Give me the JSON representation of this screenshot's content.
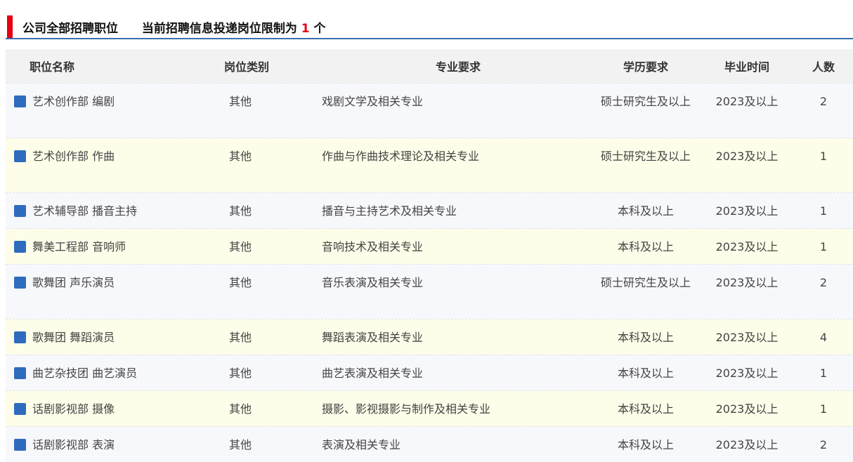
{
  "header": {
    "title": "公司全部招聘职位",
    "limit_prefix": "当前招聘信息投递岗位限制为",
    "limit_number": "1",
    "limit_suffix": "个",
    "accent_color": "#e60012",
    "rule_color": "#3a6fb0"
  },
  "table": {
    "columns": [
      "职位名称",
      "岗位类别",
      "专业要求",
      "学历要求",
      "毕业时间",
      "人数"
    ],
    "rows": [
      {
        "name": "艺术创作部 编剧",
        "category": "其他",
        "major": "戏剧文学及相关专业",
        "education": "硕士研究生及以上",
        "grad": "2023及以上",
        "count": "2"
      },
      {
        "name": "艺术创作部 作曲",
        "category": "其他",
        "major": "作曲与作曲技术理论及相关专业",
        "education": "硕士研究生及以上",
        "grad": "2023及以上",
        "count": "1"
      },
      {
        "name": "艺术辅导部 播音主持",
        "category": "其他",
        "major": "播音与主持艺术及相关专业",
        "education": "本科及以上",
        "grad": "2023及以上",
        "count": "1"
      },
      {
        "name": "舞美工程部 音响师",
        "category": "其他",
        "major": "音响技术及相关专业",
        "education": "本科及以上",
        "grad": "2023及以上",
        "count": "1"
      },
      {
        "name": "歌舞团 声乐演员",
        "category": "其他",
        "major": "音乐表演及相关专业",
        "education": "硕士研究生及以上",
        "grad": "2023及以上",
        "count": "2"
      },
      {
        "name": "歌舞团 舞蹈演员",
        "category": "其他",
        "major": "舞蹈表演及相关专业",
        "education": "本科及以上",
        "grad": "2023及以上",
        "count": "4"
      },
      {
        "name": "曲艺杂技团 曲艺演员",
        "category": "其他",
        "major": "曲艺表演及相关专业",
        "education": "本科及以上",
        "grad": "2023及以上",
        "count": "1"
      },
      {
        "name": "话剧影视部 摄像",
        "category": "其他",
        "major": "摄影、影视摄影与制作及相关专业",
        "education": "本科及以上",
        "grad": "2023及以上",
        "count": "1"
      },
      {
        "name": "话剧影视部 表演",
        "category": "其他",
        "major": "表演及相关专业",
        "education": "本科及以上",
        "grad": "2023及以上",
        "count": "2"
      }
    ]
  }
}
